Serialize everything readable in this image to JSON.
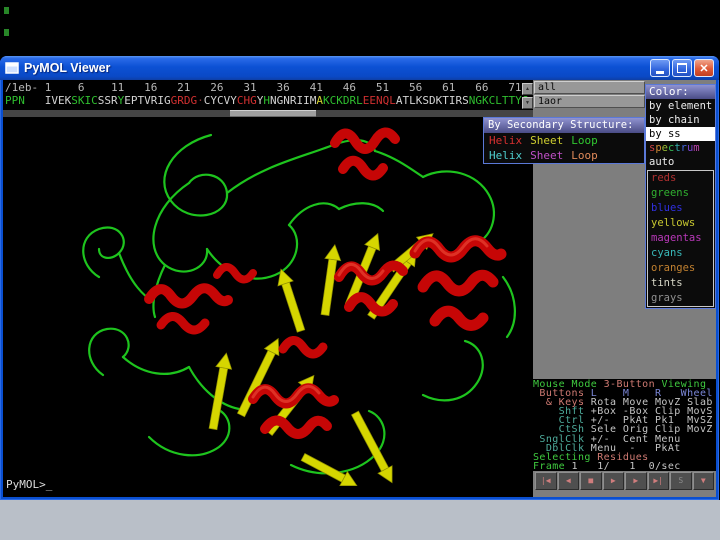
{
  "window": {
    "title": "PyMOL Viewer",
    "close_glyph": "✕"
  },
  "sequence": {
    "ruler": "/1eb- 1    6    11   16   21   26   31   36   41   46   51   56   61   66   71",
    "segments": [
      {
        "text": "PPN",
        "ss": "loop"
      },
      {
        "text": "   ",
        "ss": "none"
      },
      {
        "text": "IVEK",
        "ss": "none"
      },
      {
        "text": "SKIC",
        "ss": "loop"
      },
      {
        "text": "SSR",
        "ss": "none"
      },
      {
        "text": "Y",
        "ss": "loop"
      },
      {
        "text": "EPTVRIG",
        "ss": "none"
      },
      {
        "text": "GRDG",
        "ss": "helix"
      },
      {
        "text": "·",
        "ss": "dim"
      },
      {
        "text": "CYCVY",
        "ss": "none"
      },
      {
        "text": "CHG",
        "ss": "helix"
      },
      {
        "text": "Y",
        "ss": "none"
      },
      {
        "text": "H",
        "ss": "loop"
      },
      {
        "text": "NGNRIIM",
        "ss": "none"
      },
      {
        "text": "A",
        "ss": "sheet"
      },
      {
        "text": "KCKDRL",
        "ss": "loop"
      },
      {
        "text": "EENQL",
        "ss": "helix"
      },
      {
        "text": "A",
        "ss": "none"
      },
      {
        "text": "TLKSDK",
        "ss": "none"
      },
      {
        "text": "TIRS",
        "ss": "none"
      },
      {
        "text": "NGKCLTTYG",
        "ss": "loop"
      }
    ],
    "scroll_up": "▲",
    "scroll_down": "▼"
  },
  "objects": {
    "all": "all",
    "entry": "1aor"
  },
  "color_menu": {
    "title": "Color:",
    "by_element": "by element",
    "by_chain": "by chain",
    "by_ss": "by ss",
    "selected_item": "by ss",
    "spectrum_letters": [
      "s",
      "p",
      "e",
      "c",
      "t",
      "r",
      "u",
      "m"
    ],
    "auto": "auto",
    "swatches": [
      {
        "label": "reds",
        "hex": "#b03030"
      },
      {
        "label": "greens",
        "hex": "#30b030"
      },
      {
        "label": "blues",
        "hex": "#3030e0"
      },
      {
        "label": "yellows",
        "hex": "#c8c830"
      },
      {
        "label": "magentas",
        "hex": "#b838b8"
      },
      {
        "label": "cyans",
        "hex": "#38b8b8"
      },
      {
        "label": "oranges",
        "hex": "#c08030"
      },
      {
        "label": "tints",
        "hex": "#d8d8c8"
      },
      {
        "label": "grays",
        "hex": "#909090"
      }
    ]
  },
  "ss_menu": {
    "title": "By Secondary Structure:",
    "row1": [
      {
        "label": "Helix"
      },
      {
        "label": "Sheet"
      },
      {
        "label": "Loop"
      }
    ],
    "row2": [
      {
        "label": "Helix"
      },
      {
        "label": "Sheet"
      },
      {
        "label": "Loop"
      }
    ]
  },
  "mouse_panel": {
    "lines": [
      [
        {
          "t": "Mouse Mode ",
          "c": "g"
        },
        {
          "t": "3-Button ",
          "c": "s"
        },
        {
          "t": "Viewing",
          "c": "g"
        }
      ],
      [
        {
          "t": " Buttons ",
          "c": "s"
        },
        {
          "t": "L    M    R   Wheel",
          "c": "b"
        }
      ],
      [
        {
          "t": "  & Keys ",
          "c": "s"
        },
        {
          "t": "Rota Move MovZ Slab",
          "c": "v"
        }
      ],
      [
        {
          "t": "    Shft ",
          "c": "t"
        },
        {
          "t": "+Box -Box Clip MovS",
          "c": "v"
        }
      ],
      [
        {
          "t": "    Ctrl ",
          "c": "t"
        },
        {
          "t": "+/-  PkAt Pk1  MvSZ",
          "c": "v"
        }
      ],
      [
        {
          "t": "    CtSh ",
          "c": "t"
        },
        {
          "t": "Sele Orig Clip MovZ",
          "c": "v"
        }
      ],
      [
        {
          "t": " SnglClk ",
          "c": "t"
        },
        {
          "t": "+/-  Cent Menu",
          "c": "v"
        }
      ],
      [
        {
          "t": "  DblClk ",
          "c": "t"
        },
        {
          "t": "Menu  -   PkAt",
          "c": "v"
        }
      ],
      [
        {
          "t": "Selecting ",
          "c": "g"
        },
        {
          "t": "Residues",
          "c": "s"
        }
      ],
      [
        {
          "t": "Frame ",
          "c": "g"
        },
        {
          "t": "1   1/   1  0/sec",
          "c": "v"
        }
      ]
    ]
  },
  "playback": {
    "buttons": [
      {
        "name": "go-to-start-button",
        "glyph": "|◀"
      },
      {
        "name": "step-back-button",
        "glyph": "◀"
      },
      {
        "name": "stop-button",
        "glyph": "■"
      },
      {
        "name": "play-button",
        "glyph": "▶"
      },
      {
        "name": "step-forward-button",
        "glyph": "▶"
      },
      {
        "name": "go-to-end-button",
        "glyph": "▶|"
      },
      {
        "name": "loop-button",
        "glyph": "S"
      },
      {
        "name": "menu-button",
        "glyph": "▼"
      }
    ]
  },
  "prompt": "PyMOL>_",
  "viewport": {
    "representation": "cartoon",
    "colors": {
      "helix": "#c60606",
      "sheet": "#d6d600",
      "loop": "#1ec41e",
      "background": "#000000"
    }
  },
  "colors": {
    "titlebar_blue": "#0a4fd0",
    "panel_gray": "#7e7e7e",
    "menu_border": "#5b79d8",
    "menu_header": "#8486c8"
  }
}
